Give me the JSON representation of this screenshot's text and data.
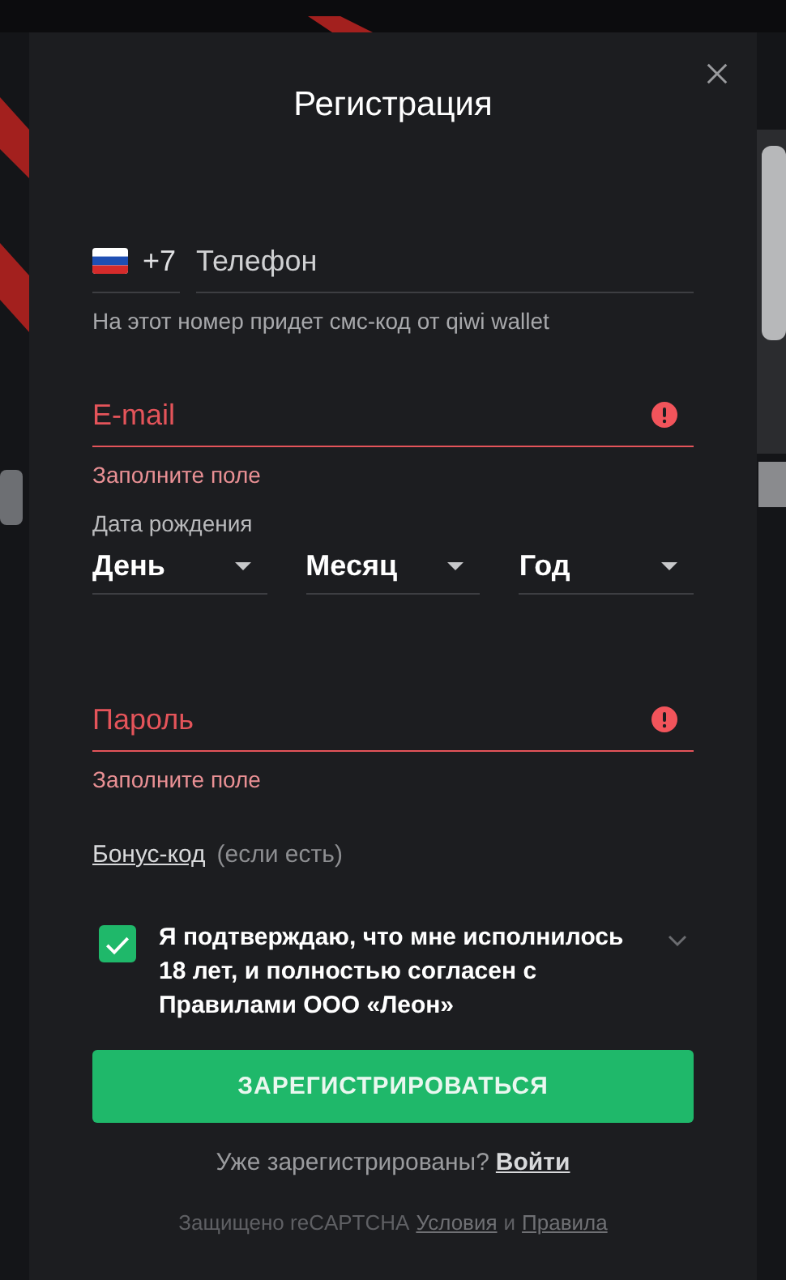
{
  "dialog": {
    "title": "Регистрация"
  },
  "phone": {
    "country_code": "+7",
    "placeholder": "Телефон",
    "hint": "На этот номер придет смс-код от qiwi wallet"
  },
  "email": {
    "placeholder": "E-mail",
    "invalid": true,
    "error": "Заполните поле"
  },
  "birth_date": {
    "label": "Дата рождения",
    "selects": [
      {
        "placeholder": "День"
      },
      {
        "placeholder": "Месяц"
      },
      {
        "placeholder": "Год"
      }
    ]
  },
  "password": {
    "placeholder": "Пароль",
    "invalid": true,
    "error": "Заполните поле"
  },
  "bonus": {
    "link": "Бонус-код",
    "note": "(если есть)"
  },
  "agreement": {
    "checked": true,
    "text": "Я подтверждаю, что мне исполнилось 18 лет, и полностью согласен с Правилами ООО «Леон»"
  },
  "submit": "ЗАРЕГИСТРИРОВАТЬСЯ",
  "login": {
    "text": "Уже зарегистрированы?",
    "link": "Войти"
  },
  "recaptcha": {
    "text": "Защищено reCAPTCHA",
    "terms": "Условия",
    "and": "и",
    "privacy": "Правила"
  }
}
